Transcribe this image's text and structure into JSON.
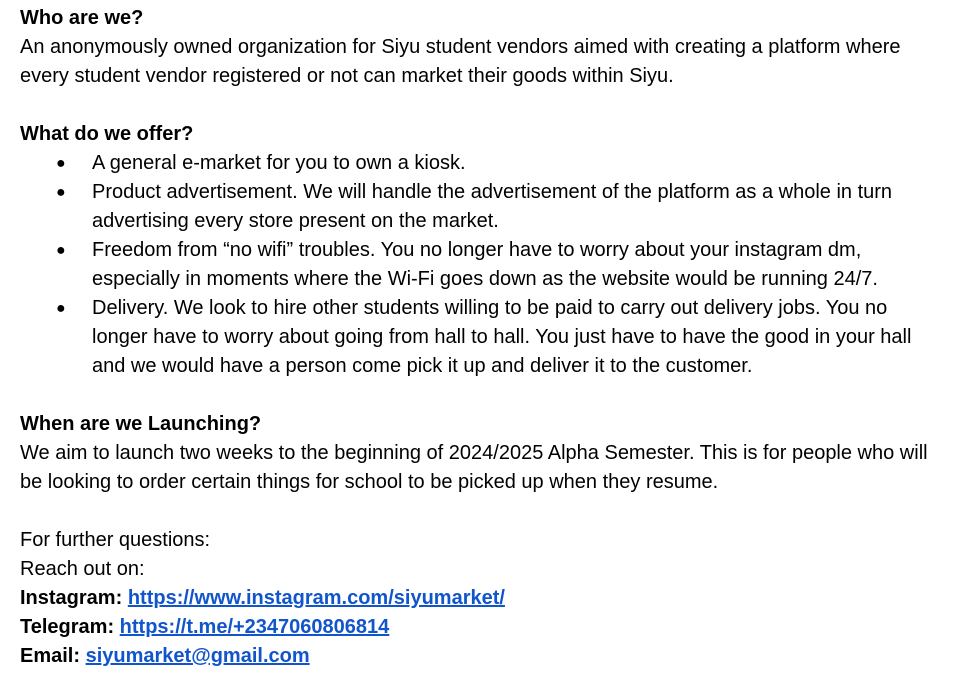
{
  "who": {
    "heading": "Who are we?",
    "text": "An anonymously owned organization for Siyu student vendors aimed with creating a platform where every student vendor registered or not can market their goods within Siyu."
  },
  "offer": {
    "heading": "What do we offer?",
    "bullet_glyph": "●",
    "items": [
      "A general e-market for you to own a kiosk.",
      "Product advertisement. We will handle the advertisement of the platform as a whole in turn advertising every store present on the market.",
      "Freedom from “no wifi” troubles. You no longer have to worry about your instagram dm, especially in moments where the Wi-Fi goes down as the website would be running 24/7.",
      "Delivery. We look to hire other students willing to be paid to carry out delivery jobs. You no longer have to worry about going from hall to hall. You just have to have the good in your hall and we would have a person come pick it up and deliver it to the customer."
    ]
  },
  "launch": {
    "heading": "When are we Launching?",
    "text": "We aim to launch two weeks to the beginning of 2024/2025 Alpha Semester. This is for people who will be looking to order certain things for school to be picked up when they resume."
  },
  "contact": {
    "intro": "For further questions:",
    "reach": "Reach out on:",
    "instagram_label": "Instagram:",
    "instagram_link": "https://www.instagram.com/siyumarket/",
    "telegram_label": "Telegram:",
    "telegram_link": "https://t.me/+2347060806814",
    "email_label": "Email:",
    "email_link": "siyumarket@gmail.com"
  },
  "colors": {
    "text": "#000000",
    "link": "#1155cc",
    "background": "#ffffff"
  }
}
